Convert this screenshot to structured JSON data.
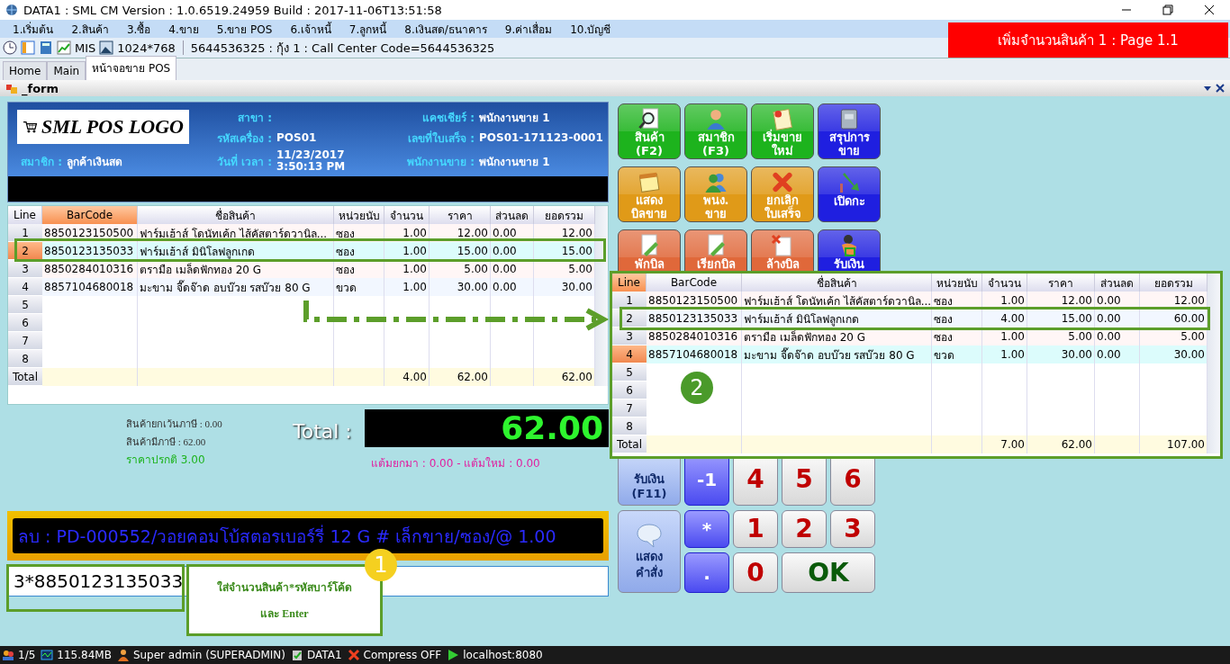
{
  "window": {
    "title": "DATA1 : SML CM Version : 1.0.6519.24959  Build : 2017-11-06T13:51:58"
  },
  "menu": [
    "1.เริ่มต้น",
    "2.สินค้า",
    "3.ซื้อ",
    "4.ขาย",
    "5.ขาย POS",
    "6.เจ้าหนี้",
    "7.ลูกหนี้",
    "8.เงินสด/ธนาคาร",
    "9.ค่าเสื่อม",
    "10.บัญชี"
  ],
  "toolbar": {
    "mis": "MIS",
    "resolution": "1024*768",
    "info": "5644536325 : กุ้ง 1 : Call Center Code=5644536325"
  },
  "banner": "เพิ่มจำนวนสินค้า 1 : Page 1.1",
  "tabs": [
    {
      "label": "Home",
      "selected": false
    },
    {
      "label": "Main",
      "selected": false
    },
    {
      "label": "หน้าจอขาย POS",
      "selected": true
    }
  ],
  "form_title": "_form",
  "header": {
    "logo": "SML POS LOGO",
    "member": {
      "label": "สมาชิก :",
      "value": "ลูกค้าเงินสด"
    },
    "branch": {
      "label": "สาขา :"
    },
    "machine": {
      "label": "รหัสเครื่อง :",
      "value": "POS01"
    },
    "datetime": {
      "label": "วันที่ เวลา :",
      "date": "11/23/2017",
      "time": "3:50:13 PM"
    },
    "cashier": {
      "label": "แคชเชียร์ :",
      "value": "พนักงานขาย 1"
    },
    "receipt": {
      "label": "เลขที่ใบเสร็จ :",
      "value": "POS01-171123-0001"
    },
    "salesperson": {
      "label": "พนักงานขาย :",
      "value": "พนักงานขาย 1"
    }
  },
  "table": {
    "columns": [
      {
        "label": "Line",
        "active": false
      },
      {
        "label": "BarCode",
        "active": true
      },
      {
        "label": "ชื่อสินค้า",
        "active": false
      },
      {
        "label": "หน่วยนับ",
        "active": false
      },
      {
        "label": "จำนวน",
        "active": false
      },
      {
        "label": "ราคา",
        "active": false
      },
      {
        "label": "ส่วนลด",
        "active": false
      },
      {
        "label": "ยอดรวม",
        "active": false
      }
    ],
    "rows": [
      {
        "line": "1",
        "barcode": "8850123150500",
        "name": "ฟาร์มเฮ้าส์  โดนัทเค้ก ไส้คัสตาร์ดวานิล...",
        "unit": "ซอง",
        "qty": "1.00",
        "price": "12.00",
        "discount": "0.00",
        "amount": "12.00",
        "selected": false
      },
      {
        "line": "2",
        "barcode": "8850123135033",
        "name": "ฟาร์มเฮ้าส์  มินิโลฟลูกเกด",
        "unit": "ซอง",
        "qty": "1.00",
        "price": "15.00",
        "discount": "0.00",
        "amount": "15.00",
        "selected": true
      },
      {
        "line": "3",
        "barcode": "8850284010316",
        "name": "ตรามือ  เมล็ดฟักทอง  20 G",
        "unit": "ซอง",
        "qty": "1.00",
        "price": "5.00",
        "discount": "0.00",
        "amount": "5.00",
        "selected": false
      },
      {
        "line": "4",
        "barcode": "8857104680018",
        "name": "มะขาม จี๊ดจ๊าด อบบ๊วย รสบ๊วย 80 G",
        "unit": "ขวด",
        "qty": "1.00",
        "price": "30.00",
        "discount": "0.00",
        "amount": "30.00",
        "selected": false
      },
      {
        "line": "5",
        "selected": false
      },
      {
        "line": "6",
        "selected": false
      },
      {
        "line": "7",
        "selected": false
      },
      {
        "line": "8",
        "selected": false
      }
    ],
    "total": {
      "line": "Total",
      "qty": "4.00",
      "price": "62.00",
      "amount": "62.00"
    }
  },
  "summary": {
    "exempt": "สินค้ายกเว้นภาษี : 0.00",
    "taxable": "สินค้ามีภาษี : 62.00",
    "normal_price": "ราคาปรกติ 3.00",
    "total_label": "Total :",
    "total_value": "62.00",
    "points": "แต้มยกมา : 0.00 - แต้มใหม่ : 0.00"
  },
  "message": "ลบ : PD-000552/วอยคอมโบ้สตอรเบอร์รี่ 12 G # เล็กขาย/ซอง/@ 1.00",
  "input": {
    "value": "3*8850123135033"
  },
  "callout": {
    "badge": "1",
    "lines": [
      "ใส่จำนวนสินค้า*รหัสบาร์โค้ด",
      "และ Enter"
    ]
  },
  "buttons": [
    {
      "lines": [
        "สินค้า",
        "(F2)"
      ],
      "color": "#1db31d"
    },
    {
      "lines": [
        "สมาชิก",
        "(F3)"
      ],
      "color": "#1db31d"
    },
    {
      "lines": [
        "เริ่มขาย",
        "ใหม่"
      ],
      "color": "#1db31d"
    },
    {
      "lines": [
        "สรุปการ",
        "ขาย"
      ],
      "color": "#1f1fe0"
    },
    {
      "lines": [
        "แสดง",
        "บิลขาย"
      ],
      "color": "#e09a18"
    },
    {
      "lines": [
        "พนง.",
        "ขาย"
      ],
      "color": "#e09a18"
    },
    {
      "lines": [
        "ยกเลิก",
        "ใบเสร็จ"
      ],
      "color": "#e09a18"
    },
    {
      "lines": [
        "เปิดกะ"
      ],
      "color": "#1f1fe0"
    },
    {
      "lines": [
        "พักบิล"
      ],
      "color": "#e0683a"
    },
    {
      "lines": [
        "เรียกบิล"
      ],
      "color": "#e0683a"
    },
    {
      "lines": [
        "ล้างบิล"
      ],
      "color": "#e0683a"
    },
    {
      "lines": [
        "รับเงิน"
      ],
      "color": "#1f1fe0"
    }
  ],
  "keypad": [
    {
      "kind": "action",
      "lines": [
        "รับเงิน",
        "(F11)"
      ]
    },
    {
      "kind": "op",
      "lines": [
        "-1"
      ]
    },
    {
      "kind": "digit",
      "lines": [
        "4"
      ]
    },
    {
      "kind": "digit",
      "lines": [
        "5"
      ]
    },
    {
      "kind": "digit",
      "lines": [
        "6"
      ]
    },
    {
      "kind": "command",
      "lines": [
        "แสดง",
        "คำสั่ง"
      ]
    },
    {
      "kind": "op",
      "lines": [
        "*"
      ]
    },
    {
      "kind": "digit",
      "lines": [
        "1"
      ]
    },
    {
      "kind": "digit",
      "lines": [
        "2"
      ]
    },
    {
      "kind": "digit",
      "lines": [
        "3"
      ]
    },
    {
      "kind": "op",
      "lines": [
        "."
      ]
    },
    {
      "kind": "digit",
      "lines": [
        "0"
      ]
    },
    {
      "kind": "ok",
      "lines": [
        "OK"
      ]
    }
  ],
  "popup_table": {
    "badge": "2",
    "columns": [
      {
        "label": "Line",
        "active": true
      },
      {
        "label": "BarCode",
        "active": false
      },
      {
        "label": "ชื่อสินค้า",
        "active": false
      },
      {
        "label": "หน่วยนับ",
        "active": false
      },
      {
        "label": "จำนวน",
        "active": false
      },
      {
        "label": "ราคา",
        "active": false
      },
      {
        "label": "ส่วนลด",
        "active": false
      },
      {
        "label": "ยอดรวม",
        "active": false
      }
    ],
    "rows": [
      {
        "line": "1",
        "barcode": "8850123150500",
        "name": "ฟาร์มเฮ้าส์  โดนัทเค้ก ไส้คัสตาร์ดวานิล...",
        "unit": "ซอง",
        "qty": "1.00",
        "price": "12.00",
        "discount": "0.00",
        "amount": "12.00",
        "selected": false
      },
      {
        "line": "2",
        "barcode": "8850123135033",
        "name": "ฟาร์มเฮ้าส์  มินิโลฟลูกเกด",
        "unit": "ซอง",
        "qty": "4.00",
        "price": "15.00",
        "discount": "0.00",
        "amount": "60.00",
        "selected": false
      },
      {
        "line": "3",
        "barcode": "8850284010316",
        "name": "ตรามือ  เมล็ดฟักทอง  20 G",
        "unit": "ซอง",
        "qty": "1.00",
        "price": "5.00",
        "discount": "0.00",
        "amount": "5.00",
        "selected": false
      },
      {
        "line": "4",
        "barcode": "8857104680018",
        "name": "มะขาม จี๊ดจ๊าด อบบ๊วย รสบ๊วย 80 G",
        "unit": "ขวด",
        "qty": "1.00",
        "price": "30.00",
        "discount": "0.00",
        "amount": "30.00",
        "selected": true
      },
      {
        "line": "5",
        "selected": false
      },
      {
        "line": "6",
        "selected": false
      },
      {
        "line": "7",
        "selected": false
      },
      {
        "line": "8",
        "selected": false
      }
    ],
    "total": {
      "line": "Total",
      "qty": "7.00",
      "price": "62.00",
      "amount": "107.00"
    }
  },
  "status_bar": [
    "1/5",
    "115.84MB",
    "Super admin (SUPERADMIN)",
    "DATA1",
    "Compress OFF",
    "localhost:8080"
  ]
}
